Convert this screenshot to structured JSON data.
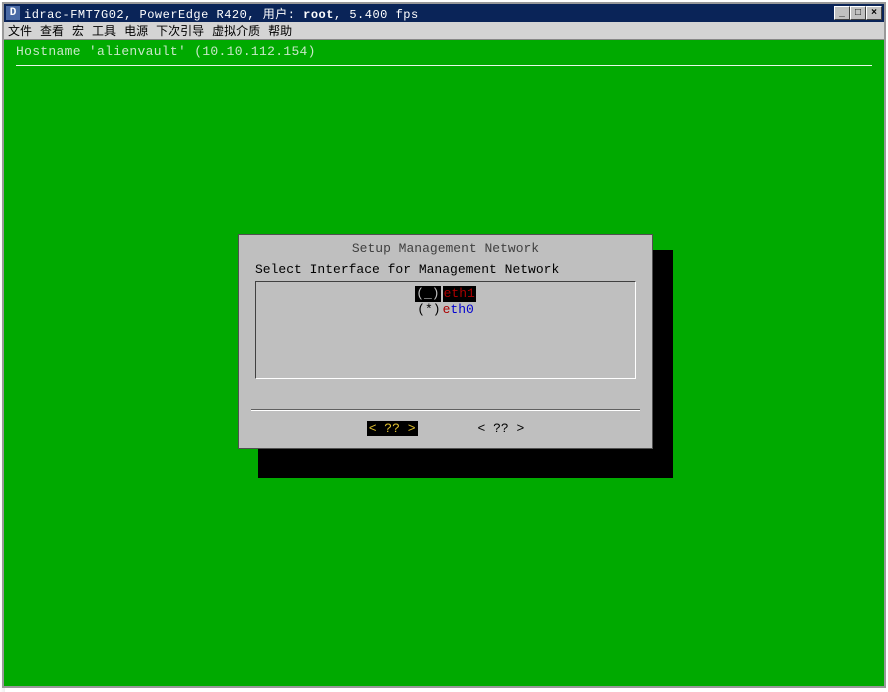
{
  "titlebar": {
    "icon_letter": "D",
    "text_prefix": "idrac-FMT7G02, PowerEdge R420, 用户: ",
    "user": "root",
    "text_suffix": ", 5.400 fps"
  },
  "window_controls": {
    "minimize": "_",
    "maximize": "□",
    "close": "×"
  },
  "menubar": {
    "items": [
      "文件",
      "查看",
      "宏",
      "工具",
      "电源",
      "下次引导",
      "虚拟介质",
      "帮助"
    ]
  },
  "console": {
    "hostname_line": "Hostname 'alienvault' (10.10.112.154)"
  },
  "dialog": {
    "title": "Setup Management Network",
    "prompt": "Select Interface for Management Network",
    "options": [
      {
        "marker": "(_)",
        "label_first": "e",
        "label_rest": "th1",
        "selected": false,
        "highlighted": true
      },
      {
        "marker": "(*)",
        "label_first": "e",
        "label_rest": "th0",
        "selected": true,
        "highlighted": false
      }
    ],
    "ok_button": "<  ??  >",
    "cancel_button": "<  ??  >"
  }
}
